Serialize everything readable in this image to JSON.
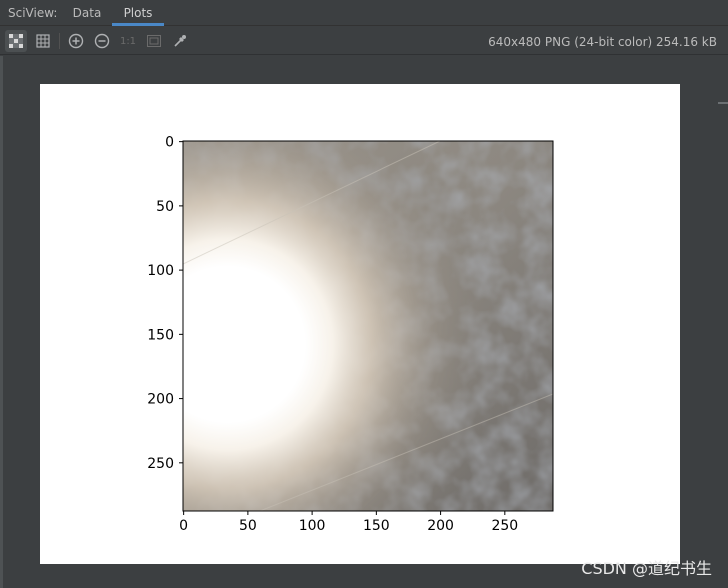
{
  "header": {
    "title": "SciView:",
    "tabs": [
      {
        "label": "Data",
        "active": false
      },
      {
        "label": "Plots",
        "active": true
      }
    ]
  },
  "toolbar": {
    "buttons": [
      {
        "icon": "transparency-checker-icon",
        "selected": true
      },
      {
        "icon": "grid-icon",
        "selected": false
      },
      {
        "icon": "zoom-in-icon",
        "selected": false
      },
      {
        "icon": "zoom-out-icon",
        "selected": false
      },
      {
        "icon": "actual-size-icon",
        "label": "1:1",
        "enabled": false
      },
      {
        "icon": "fit-to-window-icon",
        "enabled": false
      },
      {
        "icon": "color-picker-icon",
        "selected": false
      }
    ],
    "image_info": "640x480 PNG (24-bit color) 254.16 kB"
  },
  "chart_data": {
    "type": "image",
    "x_ticks": [
      "0",
      "50",
      "100",
      "150",
      "200",
      "250"
    ],
    "y_ticks": [
      "0",
      "50",
      "100",
      "150",
      "200",
      "250"
    ],
    "xlim": [
      -0.5,
      287.5
    ],
    "ylim": [
      287.5,
      -0.5
    ],
    "y_inverted": true,
    "image_size": [
      288,
      288
    ],
    "colors": {
      "background": "#8e8a84",
      "bright_spot": "#ffffff",
      "warm_tint": "#e9dccb",
      "shadow": "#6a6e74"
    }
  },
  "watermark": "CSDN @道纪书生"
}
